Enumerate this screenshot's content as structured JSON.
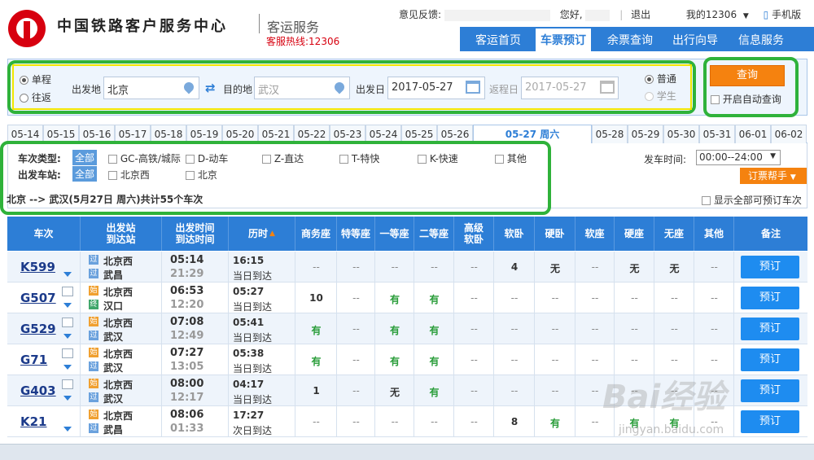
{
  "header": {
    "site_title": "中国铁路客户服务中心",
    "site_sub": "客运服务",
    "hotline": "客服热线:12306",
    "feedback_label": "意见反馈:",
    "greeting": "您好,",
    "logout": "退出",
    "my_account": "我的12306",
    "mobile": "手机版"
  },
  "nav": {
    "items": [
      "客运首页",
      "车票预订",
      "余票查询",
      "出行向导",
      "信息服务"
    ],
    "active": "车票预订"
  },
  "search": {
    "trip_one_way": "单程",
    "trip_round": "往返",
    "from_label": "出发地",
    "from_value": "北京",
    "to_label": "目的地",
    "to_value": "武汉",
    "depart_label": "出发日",
    "depart_value": "2017-05-27",
    "return_label": "返程日",
    "return_value": "2017-05-27",
    "ticket_normal": "普通",
    "ticket_student": "学生",
    "query_button": "查询",
    "auto_query": "开启自动查询"
  },
  "dates": [
    "05-14",
    "05-15",
    "05-16",
    "05-17",
    "05-18",
    "05-19",
    "05-20",
    "05-21",
    "05-22",
    "05-23",
    "05-24",
    "05-25",
    "05-26",
    "05-27 周六",
    "05-28",
    "05-29",
    "05-30",
    "05-31",
    "06-01",
    "06-02"
  ],
  "active_date": "05-27 周六",
  "filter": {
    "type_label": "车次类型:",
    "station_label": "出发车站:",
    "all": "全部",
    "types": [
      "GC-高铁/城际",
      "D-动车",
      "Z-直达",
      "T-特快",
      "K-快速",
      "其他"
    ],
    "stations": [
      "北京西",
      "北京"
    ],
    "time_label": "发车时间:",
    "time_value": "00:00--24:00",
    "helper": "订票帮手"
  },
  "summary": "北京 --> 武汉(5月27日  周六)共计55个车次",
  "show_all": "显示全部可预订车次",
  "columns": {
    "train": "车次",
    "station_a": "出发站",
    "station_b": "到达站",
    "time_a": "出发时间",
    "time_b": "到达时间",
    "duration": "历时",
    "seats": [
      "商务座",
      "特等座",
      "一等座",
      "二等座",
      "高级\n软卧",
      "软卧",
      "硬卧",
      "软座",
      "硬座",
      "无座",
      "其他"
    ],
    "remark": "备注"
  },
  "trains": [
    {
      "no": "K599",
      "from_badge": "过",
      "from": "北京西",
      "to_badge": "过",
      "to": "武昌",
      "dep": "05:14",
      "arr": "21:29",
      "dur": "16:15",
      "arrival": "当日到达",
      "seats": [
        "--",
        "--",
        "--",
        "--",
        "--",
        "4",
        "无",
        "--",
        "无",
        "无",
        "--"
      ]
    },
    {
      "no": "G507",
      "from_badge": "始",
      "from": "北京西",
      "to_badge": "终",
      "to": "汉口",
      "dep": "06:53",
      "arr": "12:20",
      "dur": "05:27",
      "arrival": "当日到达",
      "seats": [
        "10",
        "--",
        "有",
        "有",
        "--",
        "--",
        "--",
        "--",
        "--",
        "--",
        "--"
      ]
    },
    {
      "no": "G529",
      "from_badge": "始",
      "from": "北京西",
      "to_badge": "过",
      "to": "武汉",
      "dep": "07:08",
      "arr": "12:49",
      "dur": "05:41",
      "arrival": "当日到达",
      "seats": [
        "有",
        "--",
        "有",
        "有",
        "--",
        "--",
        "--",
        "--",
        "--",
        "--",
        "--"
      ]
    },
    {
      "no": "G71",
      "from_badge": "始",
      "from": "北京西",
      "to_badge": "过",
      "to": "武汉",
      "dep": "07:27",
      "arr": "13:05",
      "dur": "05:38",
      "arrival": "当日到达",
      "seats": [
        "有",
        "--",
        "有",
        "有",
        "--",
        "--",
        "--",
        "--",
        "--",
        "--",
        "--"
      ]
    },
    {
      "no": "G403",
      "from_badge": "始",
      "from": "北京西",
      "to_badge": "过",
      "to": "武汉",
      "dep": "08:00",
      "arr": "12:17",
      "dur": "04:17",
      "arrival": "当日到达",
      "seats": [
        "1",
        "--",
        "无",
        "有",
        "--",
        "--",
        "--",
        "--",
        "--",
        "--",
        "--"
      ]
    },
    {
      "no": "K21",
      "from_badge": "始",
      "from": "北京西",
      "to_badge": "过",
      "to": "武昌",
      "dep": "08:06",
      "arr": "01:33",
      "dur": "17:27",
      "arrival": "次日到达",
      "seats": [
        "--",
        "--",
        "--",
        "--",
        "--",
        "8",
        "有",
        "--",
        "有",
        "有",
        "--"
      ]
    }
  ],
  "book_label": "预订",
  "watermark": "Bai经验",
  "watermark_sub": "jingyan.baidu.com",
  "colors": {
    "brand_blue": "#2d7ed6",
    "orange": "#f5820f",
    "green_highlight": "#2fb23a",
    "yes_green": "#2a9d3a"
  }
}
